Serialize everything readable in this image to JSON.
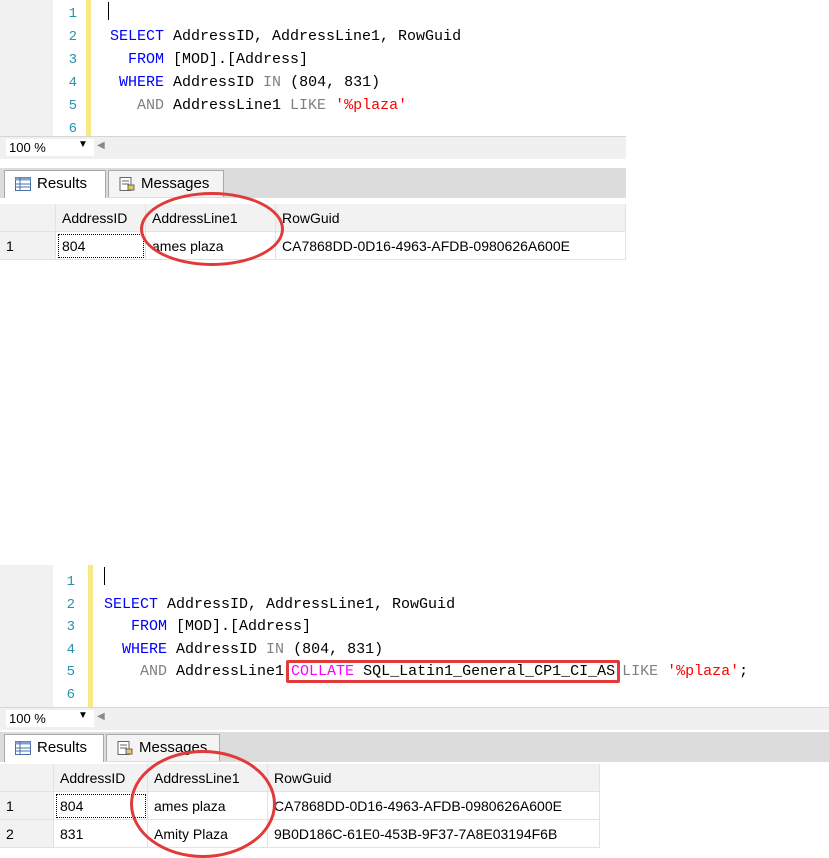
{
  "top": {
    "code_lines": [
      {
        "num": "1",
        "tokens": []
      },
      {
        "num": "2",
        "tokens": [
          {
            "t": "SELECT",
            "c": "kw"
          },
          {
            "t": " AddressID, AddressLine1, RowGuid",
            "c": "id"
          }
        ]
      },
      {
        "num": "3",
        "tokens": [
          {
            "t": "  FROM",
            "c": "kw"
          },
          {
            "t": " [MOD].[Address]",
            "c": "id"
          }
        ]
      },
      {
        "num": "4",
        "tokens": [
          {
            "t": " WHERE",
            "c": "kw"
          },
          {
            "t": " AddressID ",
            "c": "id"
          },
          {
            "t": "IN",
            "c": "op"
          },
          {
            "t": " (804, 831)",
            "c": "id"
          }
        ]
      },
      {
        "num": "5",
        "tokens": [
          {
            "t": "   AND",
            "c": "op"
          },
          {
            "t": " AddressLine1 ",
            "c": "id"
          },
          {
            "t": "LIKE",
            "c": "op"
          },
          {
            "t": " ",
            "c": "id"
          },
          {
            "t": "'%plaza'",
            "c": "str"
          }
        ]
      },
      {
        "num": "6",
        "tokens": []
      }
    ],
    "zoom": "100 %",
    "tabs": {
      "results": "Results",
      "messages": "Messages"
    },
    "grid": {
      "columns": [
        "AddressID",
        "AddressLine1",
        "RowGuid"
      ],
      "rows": [
        {
          "num": "1",
          "cells": [
            "804",
            "ames plaza",
            "CA7868DD-0D16-4963-AFDB-0980626A600E"
          ]
        }
      ]
    }
  },
  "bottom": {
    "code_lines": [
      {
        "num": "1",
        "tokens": []
      },
      {
        "num": "2",
        "tokens": [
          {
            "t": "SELECT",
            "c": "kw"
          },
          {
            "t": " AddressID, AddressLine1, RowGuid",
            "c": "id"
          }
        ]
      },
      {
        "num": "3",
        "tokens": [
          {
            "t": "   FROM",
            "c": "kw"
          },
          {
            "t": " [MOD].[Address]",
            "c": "id"
          }
        ]
      },
      {
        "num": "4",
        "tokens": [
          {
            "t": "  WHERE",
            "c": "kw"
          },
          {
            "t": " AddressID ",
            "c": "id"
          },
          {
            "t": "IN",
            "c": "op"
          },
          {
            "t": " (804, 831)",
            "c": "id"
          }
        ]
      },
      {
        "num": "5",
        "tokens": [
          {
            "t": "    AND",
            "c": "op"
          },
          {
            "t": " AddressLine1",
            "c": "id"
          },
          {
            "t": "COLLATE SQL_Latin1_General_CP1_CI_AS",
            "c": "box"
          },
          {
            "t": "LIKE",
            "c": "op"
          },
          {
            "t": " ",
            "c": "id"
          },
          {
            "t": "'%plaza'",
            "c": "str"
          },
          {
            "t": ";",
            "c": "id"
          }
        ]
      },
      {
        "num": "6",
        "tokens": []
      }
    ],
    "collate_keyword": "COLLATE",
    "collate_value": " SQL_Latin1_General_CP1_CI_AS",
    "zoom": "100 %",
    "tabs": {
      "results": "Results",
      "messages": "Messages"
    },
    "grid": {
      "columns": [
        "AddressID",
        "AddressLine1",
        "RowGuid"
      ],
      "rows": [
        {
          "num": "1",
          "cells": [
            "804",
            "ames plaza",
            "CA7868DD-0D16-4963-AFDB-0980626A600E"
          ]
        },
        {
          "num": "2",
          "cells": [
            "831",
            "Amity Plaza",
            "9B0D186C-61E0-453B-9F37-7A8E03194F6B"
          ]
        }
      ]
    }
  },
  "colors": {
    "keyword": "#0000ff",
    "operator": "#808080",
    "string": "#ff0000",
    "function": "#ff00ff",
    "highlight": "#e03a3a",
    "line_number": "#2b91af"
  }
}
